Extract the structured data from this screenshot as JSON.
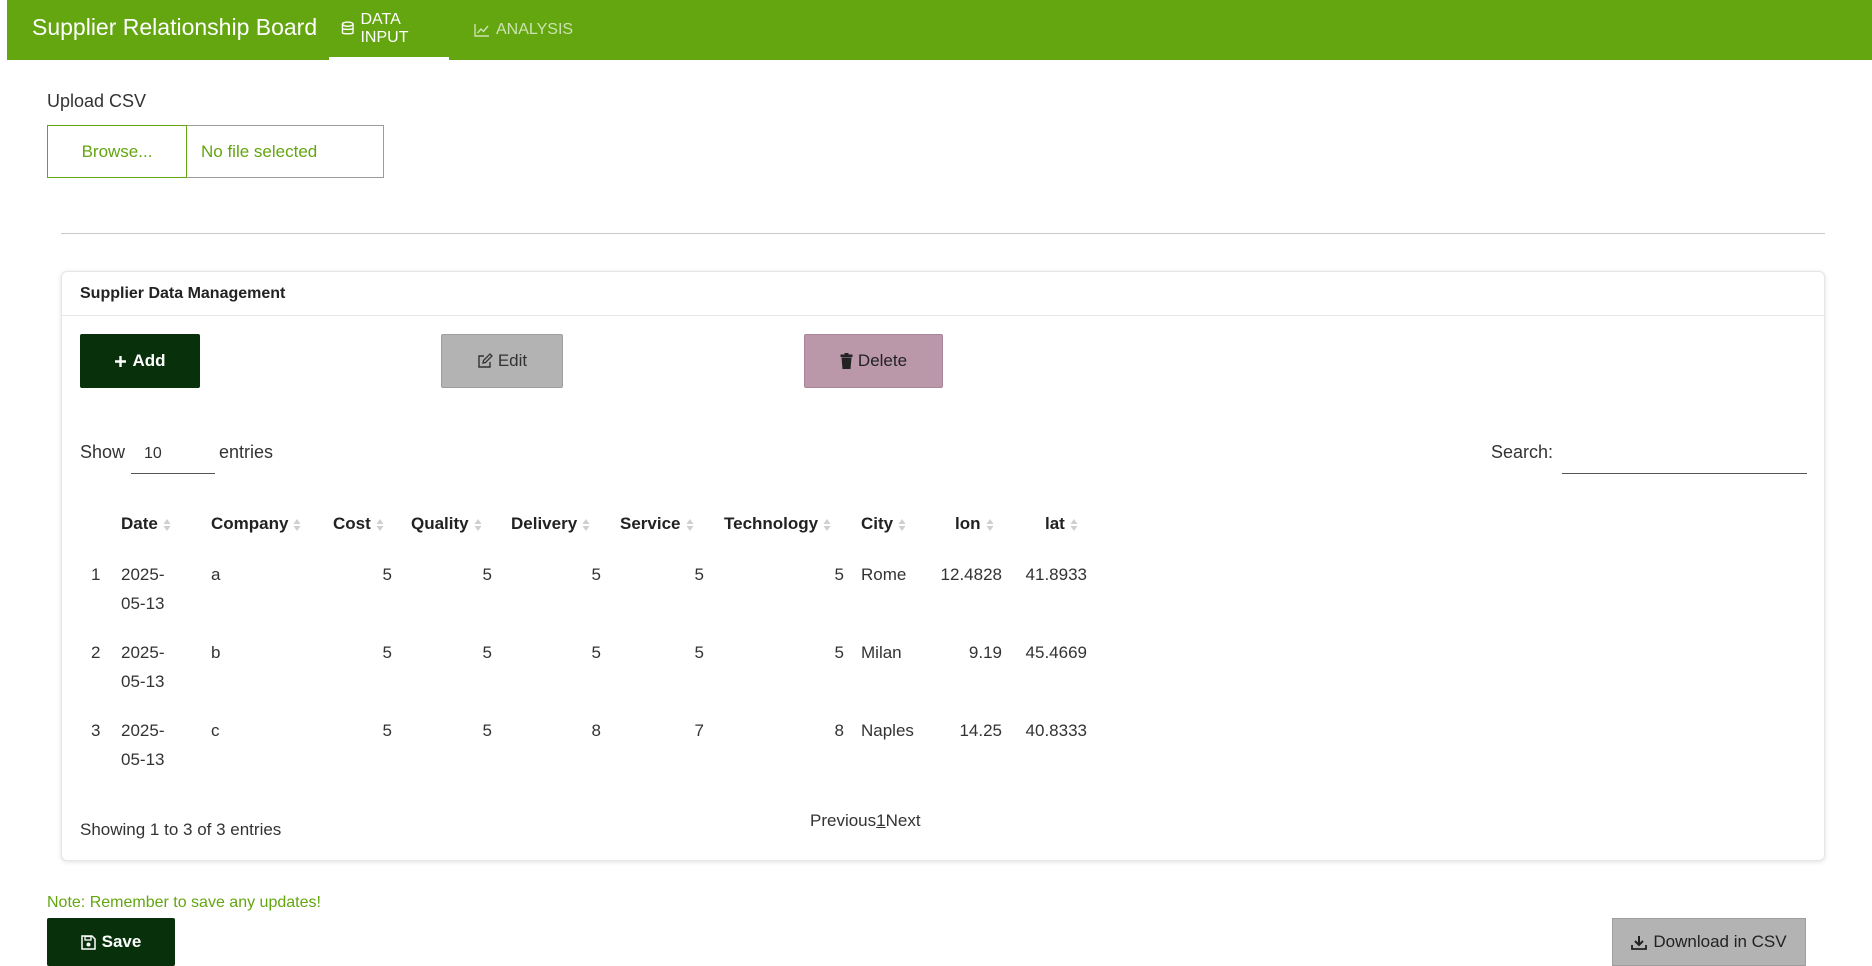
{
  "navbar": {
    "brand": "Supplier Relationship Board",
    "tabs": [
      {
        "label": "DATA INPUT",
        "icon": "database-icon"
      },
      {
        "label": "ANALYSIS",
        "icon": "line-chart-icon"
      }
    ]
  },
  "upload": {
    "label": "Upload CSV",
    "browse_label": "Browse...",
    "file_status": "No file selected"
  },
  "card": {
    "title": "Supplier Data Management",
    "buttons": {
      "add": "Add",
      "edit": "Edit",
      "delete": "Delete"
    },
    "length": {
      "show": "Show",
      "value": "10",
      "entries": "entries"
    },
    "search": {
      "label": "Search:",
      "value": ""
    },
    "table": {
      "headers": [
        "Date",
        "Company",
        "Cost",
        "Quality",
        "Delivery",
        "Service",
        "Technology",
        "City",
        "lon",
        "lat"
      ],
      "rows": [
        {
          "index": "1",
          "date_a": "2025-",
          "date_b": "05-13",
          "company": "a",
          "cost": "5",
          "quality": "5",
          "delivery": "5",
          "service": "5",
          "technology": "5",
          "city": "Rome",
          "lon": "12.4828",
          "lat": "41.8933"
        },
        {
          "index": "2",
          "date_a": "2025-",
          "date_b": "05-13",
          "company": "b",
          "cost": "5",
          "quality": "5",
          "delivery": "5",
          "service": "5",
          "technology": "5",
          "city": "Milan",
          "lon": "9.19",
          "lat": "45.4669"
        },
        {
          "index": "3",
          "date_a": "2025-",
          "date_b": "05-13",
          "company": "c",
          "cost": "5",
          "quality": "5",
          "delivery": "8",
          "service": "7",
          "technology": "8",
          "city": "Naples",
          "lon": "14.25",
          "lat": "40.8333"
        }
      ]
    },
    "info": "Showing 1 to 3 of 3 entries",
    "pagination": {
      "previous": "Previous",
      "current": "1",
      "next": "Next"
    }
  },
  "note": "Note: Remember to save any updates!",
  "save_label": "Save",
  "download_label": "Download in CSV",
  "colors": {
    "brand": "#63a610",
    "dark": "#07300b",
    "grey": "#b3b3b3",
    "delete": "#bb97aa"
  }
}
